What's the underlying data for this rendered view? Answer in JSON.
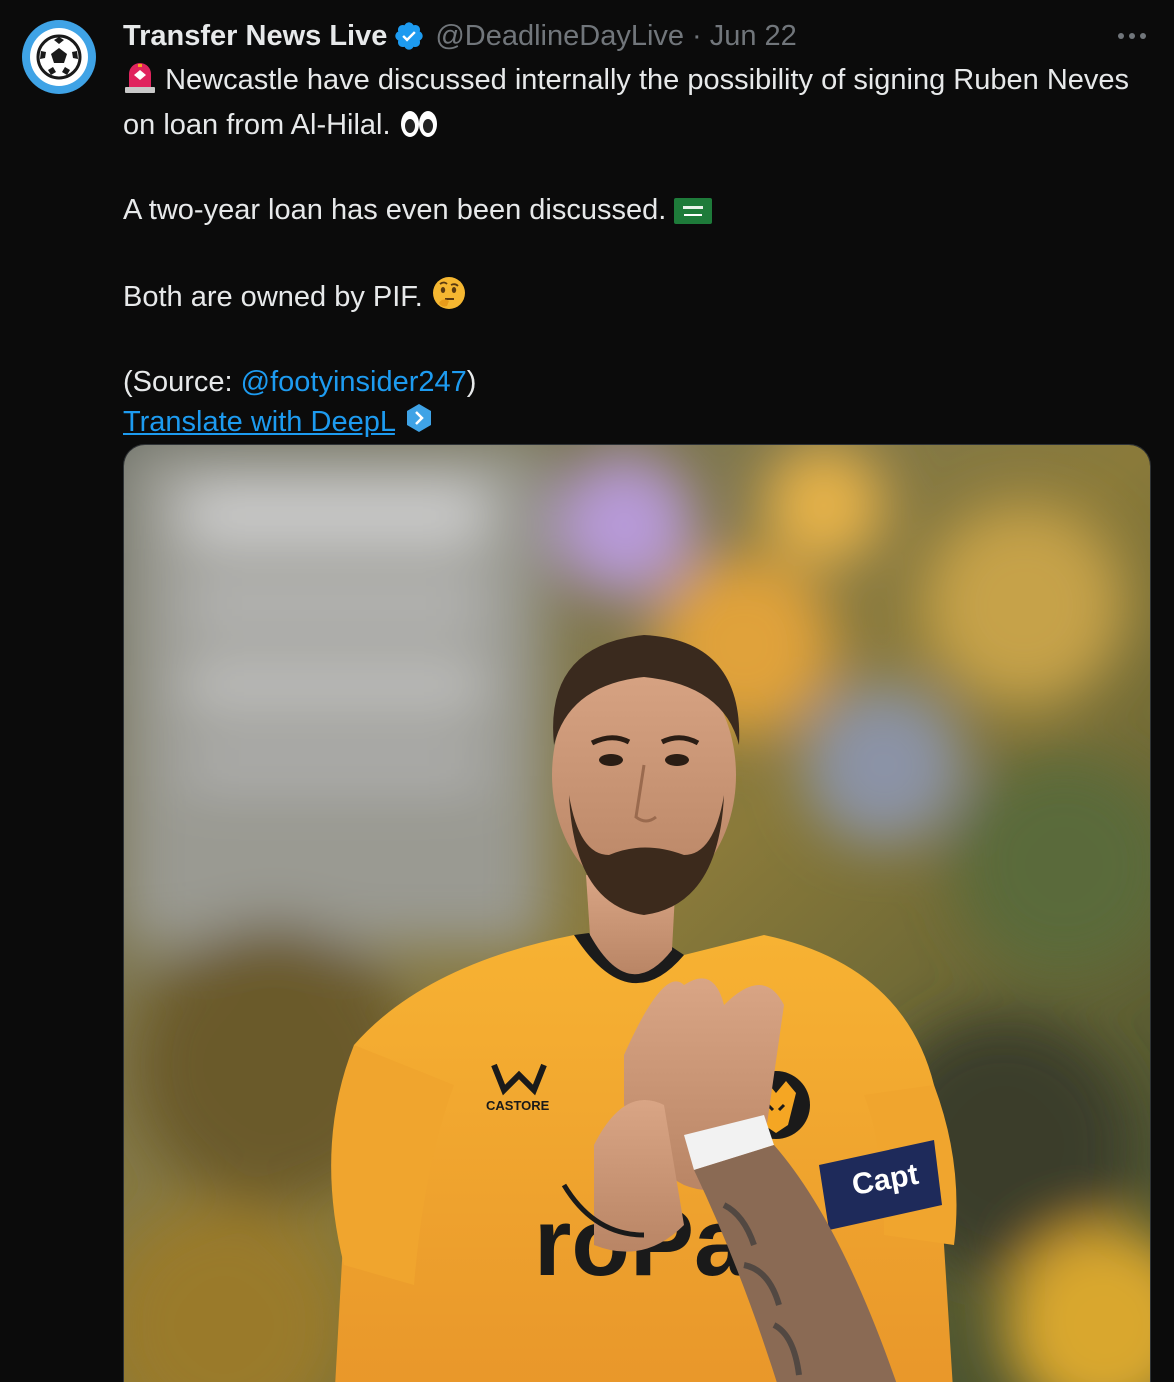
{
  "author": {
    "display_name": "Transfer News Live",
    "handle": "@DeadlineDayLive",
    "separator": "·",
    "date": "Jun 22",
    "avatar_icon": "soccer-ball-icon",
    "verified_icon": "verified-badge-icon"
  },
  "tweet": {
    "line1": "Newcastle have discussed internally the possibility of signing Ruben Neves on loan from Al-Hilal.",
    "line2": "A two-year loan has even been discussed.",
    "line3": "Both are owned by PIF.",
    "source_prefix": "(Source: ",
    "source_mention": "@footyinsider247",
    "source_suffix": ")",
    "translate_label": "Translate with DeepL"
  },
  "media": {
    "jersey_sponsor_text": "roPa",
    "jersey_brand": "CASTORE",
    "armband_text": "Capt"
  },
  "colors": {
    "accent": "#1d9bf0",
    "background": "#0b0b0b",
    "text": "#e7e9ea",
    "muted": "#71767b",
    "jersey": "#f5a623"
  }
}
